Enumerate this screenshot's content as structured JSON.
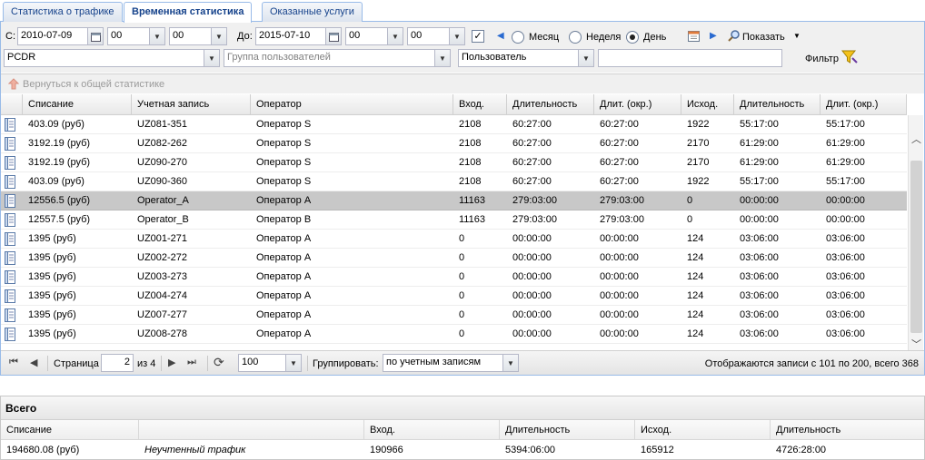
{
  "tabs": [
    "Статистика о трафике",
    "Временная статистика",
    "Оказанные услуги"
  ],
  "filters": {
    "from_label": "С:",
    "from_date": "2010-07-09",
    "from_hour": "00",
    "from_min": "00",
    "to_label": "До:",
    "to_date": "2015-07-10",
    "to_hour": "00",
    "to_min": "00",
    "period_month": "Месяц",
    "period_week": "Неделя",
    "period_day": "День",
    "show_label": "Показать",
    "pcdr": "PCDR",
    "group_placeholder": "Группа пользователей",
    "user_placeholder": "Пользователь",
    "filter_label": "Фильтр",
    "back_label": "Вернуться к общей статистике"
  },
  "grid": {
    "columns": [
      "Списание",
      "Учетная запись",
      "Оператор",
      "Вход.",
      "Длительность",
      "Длит. (окр.)",
      "Исход.",
      "Длительность",
      "Длит. (окр.)"
    ],
    "rows": [
      [
        "403.09 (руб)",
        "UZ081-351",
        "Оператор S",
        "2108",
        "60:27:00",
        "60:27:00",
        "1922",
        "55:17:00",
        "55:17:00"
      ],
      [
        "3192.19 (руб)",
        "UZ082-262",
        "Оператор S",
        "2108",
        "60:27:00",
        "60:27:00",
        "2170",
        "61:29:00",
        "61:29:00"
      ],
      [
        "3192.19 (руб)",
        "UZ090-270",
        "Оператор S",
        "2108",
        "60:27:00",
        "60:27:00",
        "2170",
        "61:29:00",
        "61:29:00"
      ],
      [
        "403.09 (руб)",
        "UZ090-360",
        "Оператор S",
        "2108",
        "60:27:00",
        "60:27:00",
        "1922",
        "55:17:00",
        "55:17:00"
      ],
      [
        "12556.5 (руб)",
        "Operator_A",
        "Оператор A",
        "11163",
        "279:03:00",
        "279:03:00",
        "0",
        "00:00:00",
        "00:00:00"
      ],
      [
        "12557.5 (руб)",
        "Operator_B",
        "Оператор B",
        "11163",
        "279:03:00",
        "279:03:00",
        "0",
        "00:00:00",
        "00:00:00"
      ],
      [
        "1395 (руб)",
        "UZ001-271",
        "Оператор A",
        "0",
        "00:00:00",
        "00:00:00",
        "124",
        "03:06:00",
        "03:06:00"
      ],
      [
        "1395 (руб)",
        "UZ002-272",
        "Оператор A",
        "0",
        "00:00:00",
        "00:00:00",
        "124",
        "03:06:00",
        "03:06:00"
      ],
      [
        "1395 (руб)",
        "UZ003-273",
        "Оператор A",
        "0",
        "00:00:00",
        "00:00:00",
        "124",
        "03:06:00",
        "03:06:00"
      ],
      [
        "1395 (руб)",
        "UZ004-274",
        "Оператор A",
        "0",
        "00:00:00",
        "00:00:00",
        "124",
        "03:06:00",
        "03:06:00"
      ],
      [
        "1395 (руб)",
        "UZ007-277",
        "Оператор A",
        "0",
        "00:00:00",
        "00:00:00",
        "124",
        "03:06:00",
        "03:06:00"
      ],
      [
        "1395 (руб)",
        "UZ008-278",
        "Оператор A",
        "0",
        "00:00:00",
        "00:00:00",
        "124",
        "03:06:00",
        "03:06:00"
      ]
    ],
    "selected_row": 4
  },
  "pager": {
    "page_label": "Страница",
    "page": "2",
    "of_label": "из 4",
    "page_size": "100",
    "group_label": "Группировать:",
    "group_value": "по учетным записям",
    "status": "Отображаются записи с 101 по 200, всего 368"
  },
  "totals": {
    "title": "Всего",
    "columns": [
      "Списание",
      "",
      "Вход.",
      "Длительность",
      "Исход.",
      "Длительность"
    ],
    "values": [
      "194680.08 (руб)",
      "Неучтенный трафик",
      "190966",
      "5394:06:00",
      "165912",
      "4726:28:00"
    ]
  },
  "colors": {
    "tab_border": "#99bbe8",
    "tab_text": "#15428b",
    "selected_row": "#c8c8c8",
    "accent_blue": "#2a6ad0"
  }
}
